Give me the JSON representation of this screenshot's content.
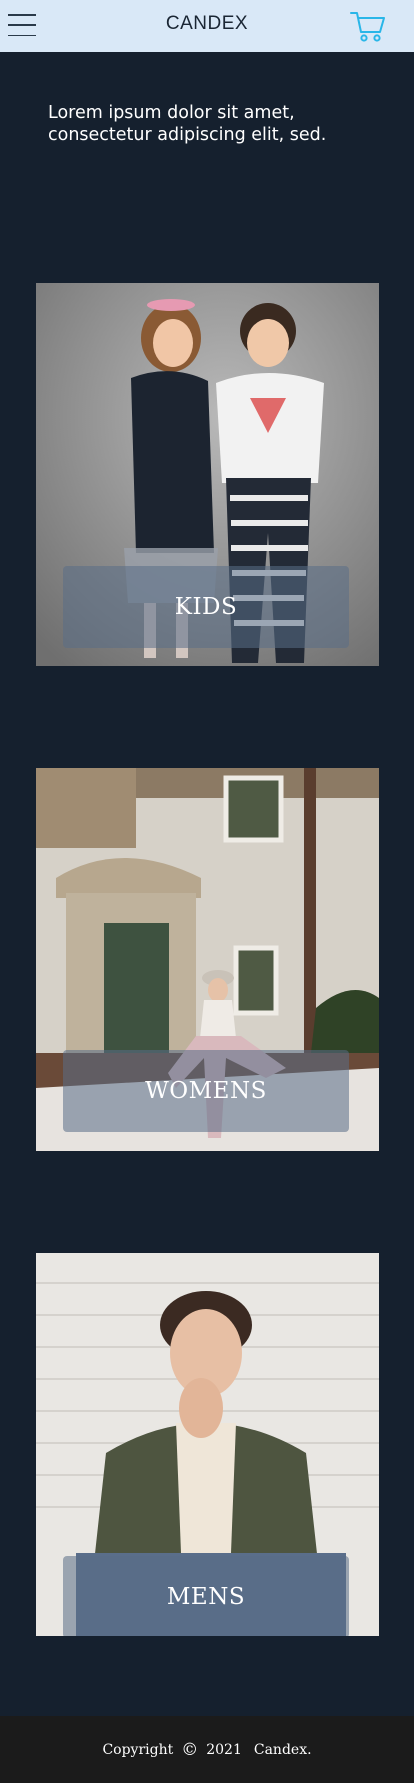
{
  "header": {
    "brand": "CANDEX",
    "menu_icon": "hamburger-menu-icon",
    "cart_icon": "shopping-cart-icon"
  },
  "intro": {
    "text": "Lorem ipsum dolor sit amet, consectetur adipiscing elit, sed."
  },
  "categories": [
    {
      "label": "KIDS"
    },
    {
      "label": "WOMENS"
    },
    {
      "label": "MENS"
    }
  ],
  "footer": {
    "copyright": "Copyright",
    "symbol": "©",
    "year": "2021",
    "company": "Candex."
  },
  "colors": {
    "header_bg": "#d9e8f7",
    "page_bg": "#15202e",
    "cart_accent": "#29b6e8",
    "footer_bg": "#1b1b1b"
  }
}
